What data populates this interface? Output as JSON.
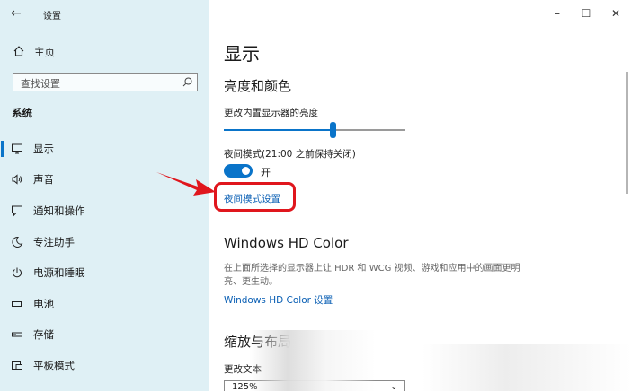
{
  "window": {
    "title": "设置",
    "back_icon": "back-arrow-icon",
    "controls": {
      "minimize": "–",
      "maximize": "☐",
      "close": "✕"
    }
  },
  "sidebar": {
    "home_label": "主页",
    "search_placeholder": "查找设置",
    "section_title": "系统",
    "items": [
      {
        "label": "显示",
        "icon": "monitor-icon",
        "selected": true
      },
      {
        "label": "声音",
        "icon": "speaker-icon",
        "selected": false
      },
      {
        "label": "通知和操作",
        "icon": "notification-icon",
        "selected": false
      },
      {
        "label": "专注助手",
        "icon": "moon-icon",
        "selected": false
      },
      {
        "label": "电源和睡眠",
        "icon": "power-icon",
        "selected": false
      },
      {
        "label": "电池",
        "icon": "battery-icon",
        "selected": false
      },
      {
        "label": "存储",
        "icon": "storage-icon",
        "selected": false
      },
      {
        "label": "平板模式",
        "icon": "tablet-icon",
        "selected": false
      }
    ]
  },
  "main": {
    "page_title": "显示",
    "brightness_section": "亮度和颜色",
    "brightness_label": "更改内置显示器的亮度",
    "brightness_value": 0.6,
    "night_mode_label": "夜间模式(21:00 之前保持关闭)",
    "night_mode_state": "开",
    "night_mode_settings_link": "夜间模式设置",
    "hd_color_title": "Windows HD Color",
    "hd_color_desc": "在上面所选择的显示器上让 HDR 和 WCG 视频、游戏和应用中的画面更明亮、更生动。",
    "hd_color_link": "Windows HD Color 设置",
    "scale_section": "缩放与布局",
    "scale_label": "更改文本",
    "scale_value": "125%"
  },
  "colors": {
    "accent": "#0a74c9",
    "sidebar_bg": "#dff0f5",
    "annotation": "#e0161d",
    "link": "#0a5fb4"
  }
}
